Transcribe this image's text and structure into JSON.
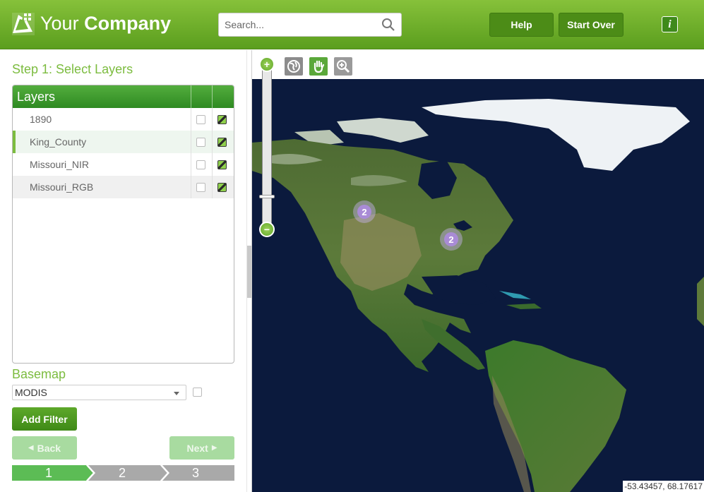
{
  "header": {
    "logo_text_regular": "Your",
    "logo_text_bold": "Company",
    "search_placeholder": "Search...",
    "help_label": "Help",
    "start_over_label": "Start Over",
    "info_label": "i"
  },
  "sidebar": {
    "step_title": "Step 1: Select Layers",
    "layers_header": "Layers",
    "layers": [
      {
        "name": "1890",
        "checked_a": false,
        "checked_b": true
      },
      {
        "name": "King_County",
        "checked_a": false,
        "checked_b": true,
        "selected": true
      },
      {
        "name": "Missouri_NIR",
        "checked_a": false,
        "checked_b": true
      },
      {
        "name": "Missouri_RGB",
        "checked_a": false,
        "checked_b": true
      }
    ],
    "basemap_title": "Basemap",
    "basemap_value": "MODIS",
    "add_filter_label": "Add Filter",
    "back_label": "Back",
    "next_label": "Next",
    "steps": [
      "1",
      "2",
      "3"
    ],
    "active_step": 1
  },
  "map": {
    "zoom_in_label": "+",
    "zoom_out_label": "−",
    "clusters": [
      {
        "count": "2"
      },
      {
        "count": "2"
      }
    ],
    "coordinates": "-53.43457, 68.17617"
  },
  "colors": {
    "brand_green": "#6fb12e",
    "title_green": "#7cbc3f",
    "cluster_purple": "#a98bd6"
  },
  "icons": [
    "logo-icon",
    "search-icon",
    "globe-icon",
    "pan-hand-icon",
    "zoom-magnifier-icon",
    "info-icon"
  ]
}
